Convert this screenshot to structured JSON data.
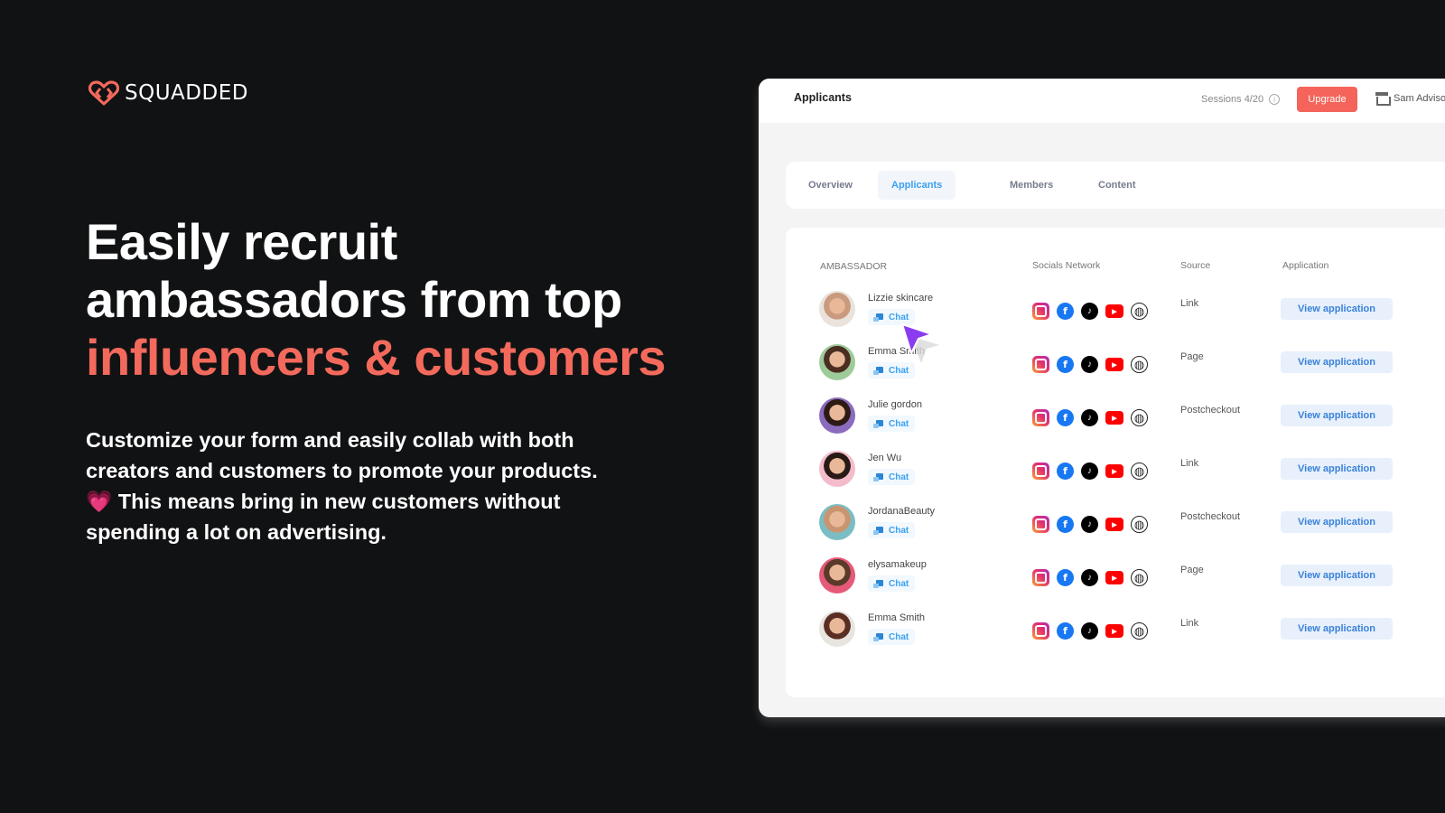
{
  "brand": {
    "name": "SQUADDED",
    "accent_color": "#f36a5c"
  },
  "hero": {
    "headline_line1": "Easily recruit",
    "headline_line2": "ambassadors from top",
    "headline_accent": "influencers & customers",
    "body_line1": "Customize your form and easily collab with both",
    "body_line2": "creators and customers to promote your products.",
    "body_heart": "💗",
    "body_line3": " This means bring in new customers without",
    "body_line4": "spending a lot on advertising."
  },
  "app": {
    "title": "Applicants",
    "sessions": "Sessions 4/20",
    "upgrade_label": "Upgrade",
    "account_name": "Sam Advisor",
    "tabs": [
      {
        "label": "Overview",
        "active": false
      },
      {
        "label": "Applicants",
        "active": true
      },
      {
        "label": "Members",
        "active": false
      },
      {
        "label": "Content",
        "active": false
      }
    ],
    "table": {
      "headers": {
        "ambassador": "AMBASSADOR",
        "socials": "Socials Network",
        "source": "Source",
        "application": "Application"
      },
      "chat_label": "Chat",
      "view_label": "View application",
      "rows": [
        {
          "name": "Lizzie skincare",
          "source": "Link"
        },
        {
          "name": "Emma Smith",
          "source": "Page"
        },
        {
          "name": "Julie gordon",
          "source": "Postcheckout"
        },
        {
          "name": "Jen Wu",
          "source": "Link"
        },
        {
          "name": "JordanaBeauty",
          "source": "Postcheckout"
        },
        {
          "name": "elysamakeup",
          "source": "Page"
        },
        {
          "name": "Emma Smith",
          "source": "Link"
        }
      ],
      "socials": [
        "instagram-icon",
        "facebook-icon",
        "tiktok-icon",
        "youtube-icon",
        "globe-icon"
      ]
    }
  }
}
